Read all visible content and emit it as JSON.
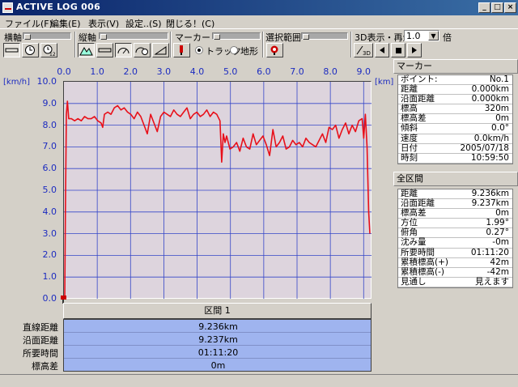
{
  "window": {
    "title": "ACTIVE LOG 006",
    "buttons": [
      "_",
      "□",
      "×"
    ]
  },
  "menu": [
    {
      "label": "ファイル(F)"
    },
    {
      "label": "編集(E)"
    },
    {
      "label": "表示(V)"
    },
    {
      "label": "設定..(S)"
    },
    {
      "label": "閉じる！(C)"
    }
  ],
  "toolbar": {
    "x_axis_label": "横軸",
    "y_axis_label": "縦軸",
    "marker_label": "マーカー",
    "selection_label": "選択範囲",
    "playback_label": "3D表示・再生",
    "speed_value": "1.0",
    "speed_unit": "倍",
    "radio_track": "トラック",
    "radio_terrain": "地形",
    "threed_btn": "3D"
  },
  "chart_data": {
    "type": "line",
    "ylabel": "[km/h]",
    "xlabel": "[km]",
    "xlim": [
      0,
      9.236
    ],
    "ylim": [
      0,
      10
    ],
    "x_ticks": [
      "0.0",
      "1.0",
      "2.0",
      "3.0",
      "4.0",
      "5.0",
      "6.0",
      "7.0",
      "8.0",
      "9.0"
    ],
    "y_ticks": [
      "10.0",
      "9.0",
      "8.0",
      "7.0",
      "6.0",
      "5.0",
      "4.0",
      "3.0",
      "2.0",
      "1.0",
      "0.0"
    ],
    "grid": true,
    "color": "#e8101a",
    "series": [
      {
        "x": [
          0.0,
          0.02,
          0.05,
          0.08,
          0.12,
          0.2,
          0.3,
          0.4,
          0.5,
          0.6,
          0.7,
          0.8,
          0.9,
          1.0,
          1.1,
          1.15,
          1.2,
          1.3,
          1.4,
          1.5,
          1.6,
          1.7,
          1.8,
          1.9,
          2.0,
          2.1,
          2.2,
          2.3,
          2.4,
          2.5,
          2.6,
          2.7,
          2.8,
          2.9,
          3.0,
          3.1,
          3.2,
          3.3,
          3.4,
          3.5,
          3.6,
          3.7,
          3.8,
          3.9,
          4.0,
          4.1,
          4.2,
          4.3,
          4.4,
          4.5,
          4.6,
          4.7,
          4.75,
          4.8,
          4.85,
          4.9,
          5.0,
          5.1,
          5.2,
          5.3,
          5.4,
          5.5,
          5.6,
          5.7,
          5.8,
          5.9,
          6.0,
          6.1,
          6.2,
          6.3,
          6.4,
          6.5,
          6.6,
          6.7,
          6.8,
          6.9,
          7.0,
          7.1,
          7.2,
          7.3,
          7.4,
          7.5,
          7.6,
          7.7,
          7.8,
          7.9,
          8.0,
          8.1,
          8.2,
          8.3,
          8.4,
          8.5,
          8.6,
          8.7,
          8.8,
          8.9,
          9.0,
          9.05,
          9.1,
          9.15,
          9.2,
          9.236
        ],
        "y": [
          0.0,
          4.0,
          8.5,
          9.1,
          8.3,
          8.3,
          8.2,
          8.3,
          8.2,
          8.4,
          8.3,
          8.3,
          8.4,
          8.2,
          8.1,
          7.9,
          8.5,
          8.6,
          8.5,
          8.8,
          8.9,
          8.7,
          8.8,
          8.6,
          8.5,
          8.3,
          8.6,
          8.4,
          8.0,
          7.6,
          8.5,
          8.1,
          7.7,
          8.4,
          8.6,
          8.5,
          8.4,
          8.7,
          8.5,
          8.4,
          8.6,
          8.8,
          8.3,
          8.5,
          8.6,
          8.4,
          8.5,
          8.7,
          8.4,
          8.6,
          8.5,
          8.2,
          6.3,
          7.6,
          7.2,
          7.5,
          6.9,
          7.0,
          7.2,
          6.8,
          7.4,
          7.0,
          6.9,
          7.6,
          7.1,
          7.3,
          7.5,
          7.1,
          6.6,
          7.8,
          7.0,
          7.2,
          7.5,
          6.9,
          7.0,
          7.3,
          7.1,
          7.2,
          7.0,
          7.4,
          7.2,
          7.1,
          7.0,
          7.3,
          7.6,
          7.2,
          7.9,
          7.8,
          8.0,
          7.4,
          7.8,
          8.1,
          7.6,
          8.0,
          7.7,
          8.2,
          8.3,
          7.4,
          8.5,
          7.0,
          4.0,
          3.0
        ]
      }
    ]
  },
  "segment": {
    "header": "区間 1",
    "rows": [
      {
        "label": "直線距離",
        "value": "9.236km"
      },
      {
        "label": "沿面距離",
        "value": "9.237km"
      },
      {
        "label": "所要時間",
        "value": "01:11:20"
      },
      {
        "label": "標高差",
        "value": "0m"
      }
    ]
  },
  "marker_panel": {
    "title": "マーカー",
    "rows": [
      {
        "k": "ポイント:",
        "v": "No.1"
      },
      {
        "k": "距離",
        "v": "0.000km"
      },
      {
        "k": "沿面距離",
        "v": "0.000km"
      },
      {
        "k": "標高",
        "v": "320m"
      },
      {
        "k": "標高差",
        "v": "0m"
      },
      {
        "k": "傾斜",
        "v": "0.0°"
      },
      {
        "k": "速度",
        "v": "0.0km/h"
      },
      {
        "k": "日付",
        "v": "2005/07/18"
      },
      {
        "k": "時刻",
        "v": "10:59:50"
      }
    ]
  },
  "total_panel": {
    "title": "全区間",
    "rows": [
      {
        "k": "距離",
        "v": "9.236km"
      },
      {
        "k": "沿面距離",
        "v": "9.237km"
      },
      {
        "k": "標高差",
        "v": "0m"
      },
      {
        "k": "方位",
        "v": "1.99°"
      },
      {
        "k": "俯角",
        "v": "0.27°"
      },
      {
        "k": "沈み量",
        "v": "-0m"
      },
      {
        "k": "所要時間",
        "v": "01:11:20"
      },
      {
        "k": "累積標高(+)",
        "v": "42m"
      },
      {
        "k": "累積標高(-)",
        "v": "-42m"
      },
      {
        "k": "見通し",
        "v": "見えます"
      }
    ]
  }
}
